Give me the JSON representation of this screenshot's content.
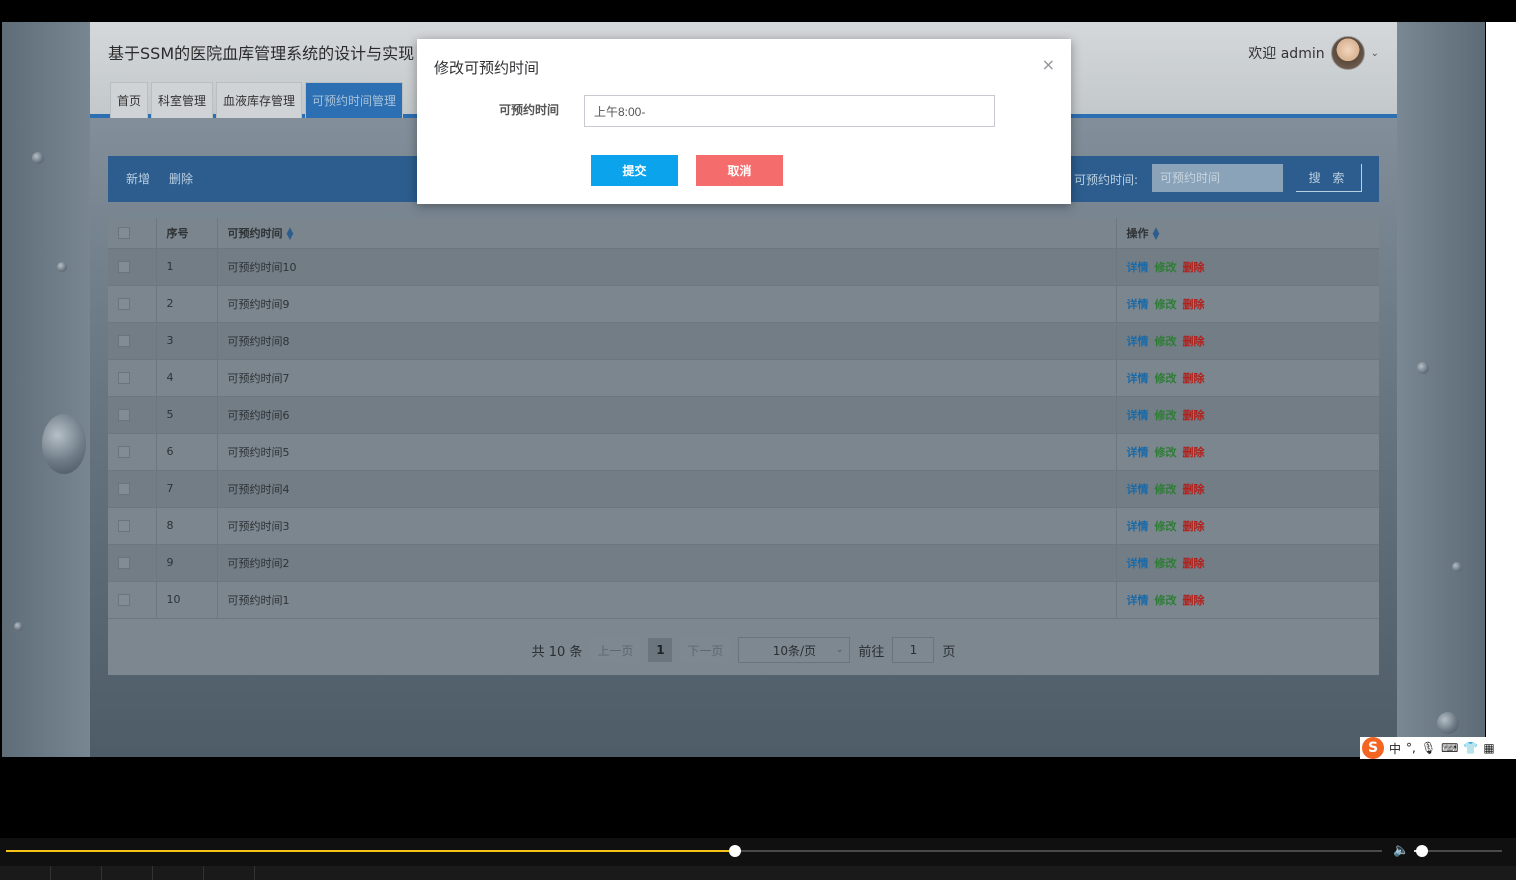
{
  "header": {
    "site_title": "基于SSM的医院血库管理系统的设计与实现",
    "welcome": "欢迎 admin",
    "nav": [
      "首页",
      "科室管理",
      "血液库存管理",
      "可预约时间管理"
    ]
  },
  "toolbar": {
    "add_label": "新增",
    "delete_label": "删除",
    "search_label": "可预约时间:",
    "search_placeholder": "可预约时间",
    "search_button": "搜 索"
  },
  "table": {
    "columns": [
      "序号",
      "可预约时间",
      "操作"
    ],
    "rows": [
      {
        "index": "1",
        "time": "可预约时间10"
      },
      {
        "index": "2",
        "time": "可预约时间9"
      },
      {
        "index": "3",
        "time": "可预约时间8"
      },
      {
        "index": "4",
        "time": "可预约时间7"
      },
      {
        "index": "5",
        "time": "可预约时间6"
      },
      {
        "index": "6",
        "time": "可预约时间5"
      },
      {
        "index": "7",
        "time": "可预约时间4"
      },
      {
        "index": "8",
        "time": "可预约时间3"
      },
      {
        "index": "9",
        "time": "可预约时间2"
      },
      {
        "index": "10",
        "time": "可预约时间1"
      }
    ],
    "actions": {
      "detail": "详情",
      "edit": "修改",
      "delete": "删除"
    }
  },
  "pagination": {
    "total": "共 10 条",
    "prev": "上一页",
    "current": "1",
    "next": "下一页",
    "page_size": "10条/页",
    "goto_label": "前往",
    "goto_value": "1",
    "page_unit": "页"
  },
  "modal": {
    "title": "修改可预约时间",
    "close": "×",
    "field_label": "可预约时间",
    "field_value": "上午8:00-",
    "submit": "提交",
    "cancel": "取消"
  },
  "ime": {
    "mode": "中"
  },
  "player": {
    "progress": 0.53,
    "volume": 0.09
  },
  "colors": {
    "accent": "#2c6fb2",
    "submit": "#0aa3ec",
    "cancel": "#f56c6c"
  }
}
